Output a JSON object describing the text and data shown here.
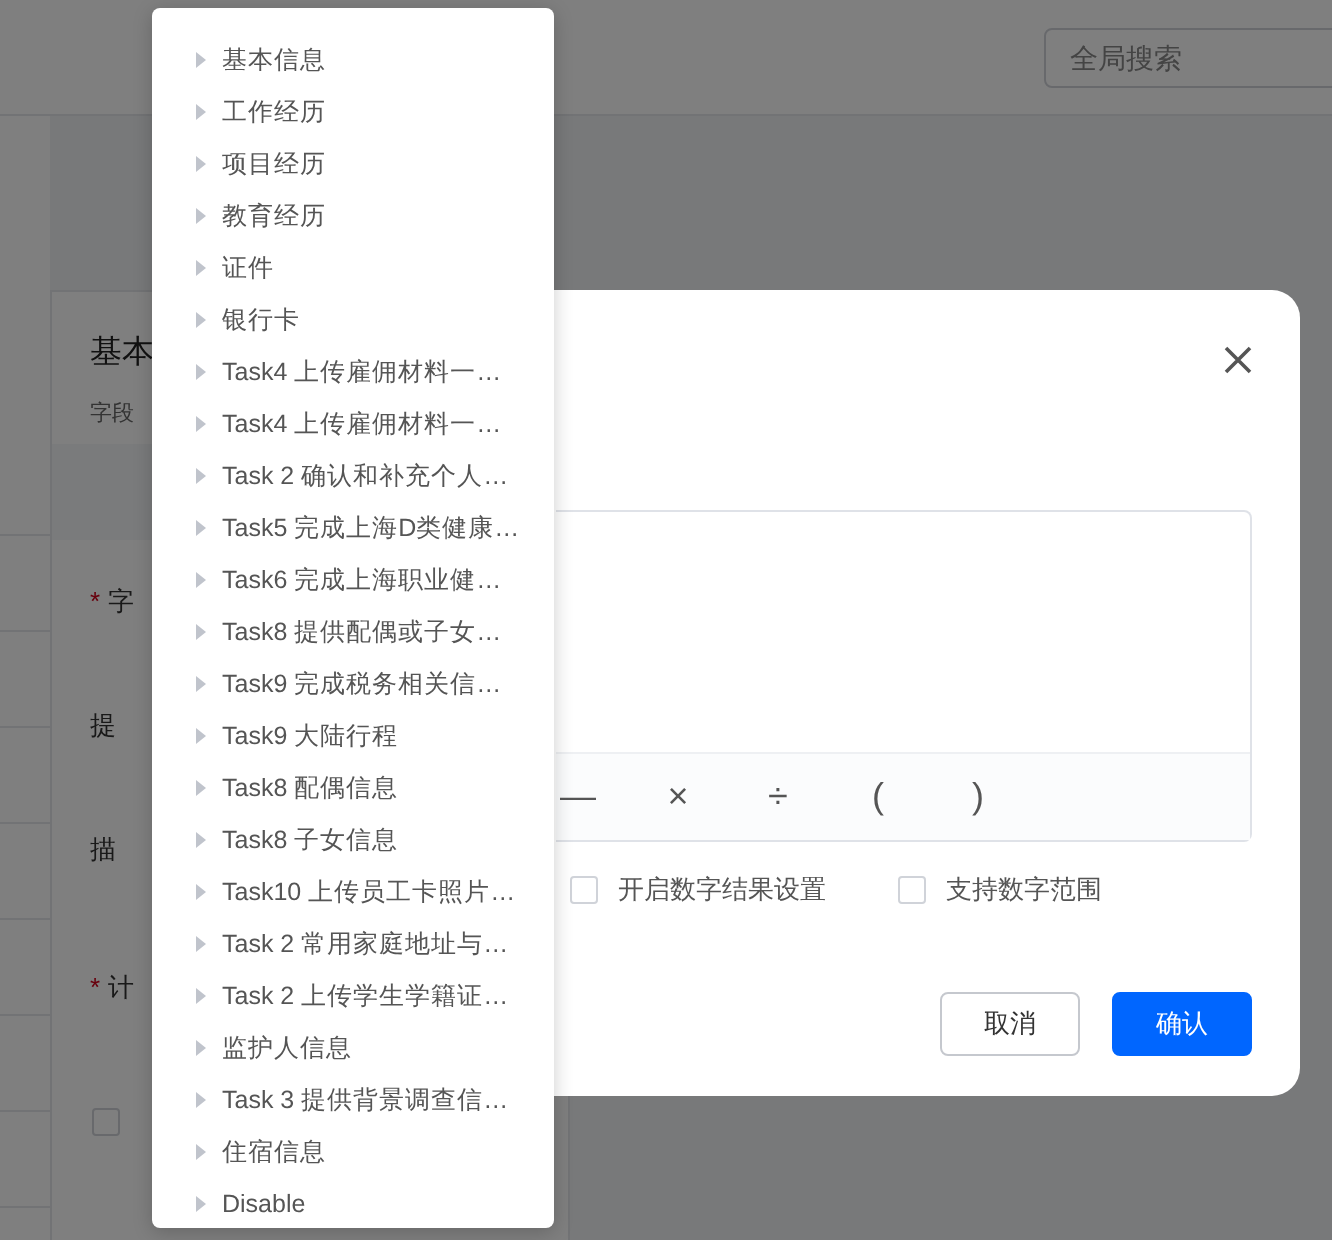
{
  "header": {
    "search": {
      "placeholder": "全局搜索"
    }
  },
  "side_panel": {
    "title": "基本",
    "subtitle": "字段",
    "fields": [
      {
        "label": "字",
        "required_mark": "*"
      },
      {
        "label": "提"
      },
      {
        "label": "描"
      },
      {
        "label": "计",
        "required_mark": "*"
      }
    ],
    "checkbox": {
      "checked": false
    }
  },
  "dialog": {
    "operators": [
      "—",
      "×",
      "÷",
      "(",
      ")"
    ],
    "options": [
      {
        "label": "开启数字结果设置",
        "checked": false
      },
      {
        "label": "支持数字范围",
        "checked": false
      }
    ],
    "buttons": [
      {
        "label": "取消",
        "kind": "secondary"
      },
      {
        "label": "确认",
        "kind": "primary"
      }
    ]
  },
  "dropdown": {
    "items": [
      {
        "label": "基本信息"
      },
      {
        "label": "工作经历"
      },
      {
        "label": "项目经历"
      },
      {
        "label": "教育经历"
      },
      {
        "label": "证件"
      },
      {
        "label": "银行卡"
      },
      {
        "label": "Task4 上传雇佣材料一…"
      },
      {
        "label": "Task4 上传雇佣材料一…"
      },
      {
        "label": "Task 2 确认和补充个人…"
      },
      {
        "label": "Task5 完成上海D类健康…"
      },
      {
        "label": "Task6 完成上海职业健…"
      },
      {
        "label": "Task8 提供配偶或子女…"
      },
      {
        "label": "Task9 完成税务相关信…"
      },
      {
        "label": "Task9 大陆行程"
      },
      {
        "label": "Task8 配偶信息"
      },
      {
        "label": "Task8 子女信息"
      },
      {
        "label": "Task10 上传员工卡照片…"
      },
      {
        "label": "Task 2 常用家庭地址与…"
      },
      {
        "label": "Task 2 上传学生学籍证…"
      },
      {
        "label": "监护人信息"
      },
      {
        "label": "Task 3 提供背景调查信…"
      },
      {
        "label": "住宿信息"
      },
      {
        "label": "Disable"
      }
    ]
  }
}
